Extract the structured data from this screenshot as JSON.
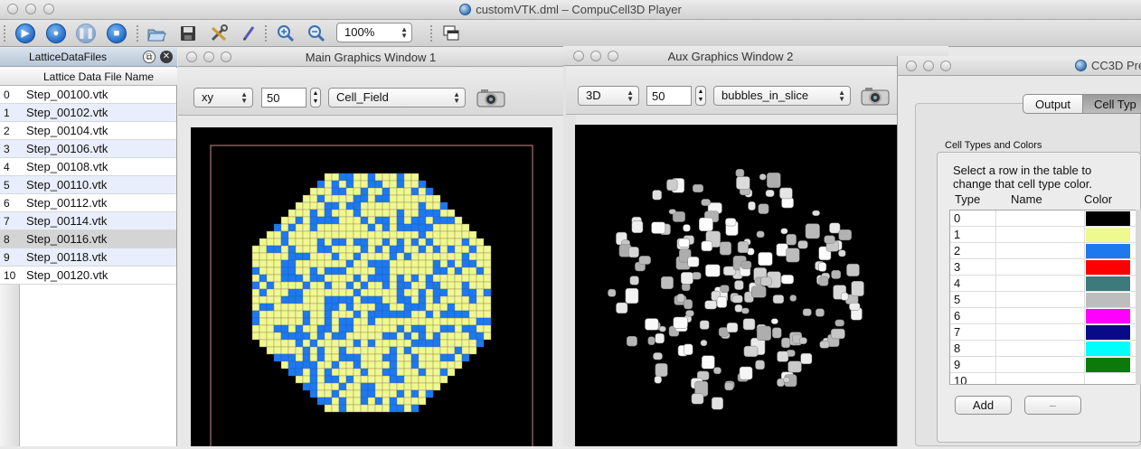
{
  "window": {
    "title": "customVTK.dml – CompuCell3D Player"
  },
  "toolbar": {
    "zoom_value": "100%"
  },
  "lattice_panel": {
    "title": "LatticeDataFiles",
    "column_header": "Lattice Data File Name",
    "selected_index": 8,
    "files": [
      {
        "index": "0",
        "name": "Step_00100.vtk"
      },
      {
        "index": "1",
        "name": "Step_00102.vtk"
      },
      {
        "index": "2",
        "name": "Step_00104.vtk"
      },
      {
        "index": "3",
        "name": "Step_00106.vtk"
      },
      {
        "index": "4",
        "name": "Step_00108.vtk"
      },
      {
        "index": "5",
        "name": "Step_00110.vtk"
      },
      {
        "index": "6",
        "name": "Step_00112.vtk"
      },
      {
        "index": "7",
        "name": "Step_00114.vtk"
      },
      {
        "index": "8",
        "name": "Step_00116.vtk"
      },
      {
        "index": "9",
        "name": "Step_00118.vtk"
      },
      {
        "index": "10",
        "name": "Step_00120.vtk"
      }
    ]
  },
  "main_graphics": {
    "title": "Main Graphics Window 1",
    "plane": "xy",
    "slice": "50",
    "field": "Cell_Field"
  },
  "aux_graphics": {
    "title": "Aux Graphics Window 2",
    "plane": "3D",
    "slice": "50",
    "field": "bubbles_in_slice"
  },
  "preferences": {
    "title": "CC3D Pre",
    "tabs": [
      "Output",
      "Cell Typ"
    ],
    "group_title": "Cell Types and Colors",
    "instructions_line1": "Select a row in the table to",
    "instructions_line2": "change that cell type color.",
    "headers": {
      "type": "Type",
      "name": "Name",
      "color": "Color"
    },
    "cell_types": [
      {
        "type": "0",
        "color": "#000000"
      },
      {
        "type": "1",
        "color": "#eef98f"
      },
      {
        "type": "2",
        "color": "#1e78ee"
      },
      {
        "type": "3",
        "color": "#ff0000"
      },
      {
        "type": "4",
        "color": "#3d7a7c"
      },
      {
        "type": "5",
        "color": "#bdbdbd"
      },
      {
        "type": "6",
        "color": "#ff00ff"
      },
      {
        "type": "7",
        "color": "#0a0a88"
      },
      {
        "type": "8",
        "color": "#00ffff"
      },
      {
        "type": "9",
        "color": "#0b7a0b"
      },
      {
        "type": "10",
        "color": "#ffffff"
      }
    ],
    "add_label": "Add",
    "remove_label": "–"
  },
  "colors": {
    "medium_cell": "#eef98f",
    "condensing_cell": "#1e78ee",
    "selected_row": "#d4d4d4",
    "alt_row": "#e8eefb"
  }
}
